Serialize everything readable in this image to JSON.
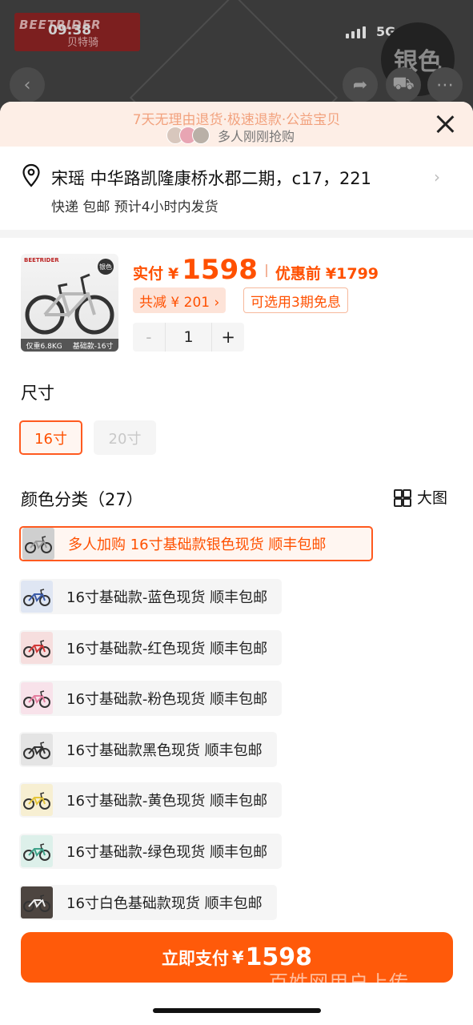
{
  "background": {
    "brand_en": "BEETRIDER",
    "brand_cn": "贝特骑",
    "status_time": "09:38",
    "network": "5G",
    "color_badge": "银色"
  },
  "banner": {
    "policies": "7天无理由退货·极速退款·公益宝贝",
    "buyers_text": "多人刚刚抢购"
  },
  "address": {
    "line": "宋瑶 中华路凯隆康桥水郡二期，c17，221",
    "delivery": "快递 包邮 预计4小时内发货"
  },
  "product": {
    "image_brand": "BEETRIDER",
    "image_badge": "银色",
    "image_weight": "仅重6.8KG",
    "image_variant": "基础款-16寸",
    "price_label": "实付",
    "currency": "¥",
    "price": "1598",
    "original_label": "优惠前",
    "original_price": "¥1799",
    "discount": "共减 ¥ 201 ›",
    "installment": "可选用3期免息",
    "quantity": "1",
    "minus": "-",
    "plus": "+"
  },
  "size": {
    "title": "尺寸",
    "options": [
      "16寸",
      "20寸"
    ]
  },
  "colors": {
    "title": "颜色分类（27）",
    "big_view": "大图",
    "options": [
      {
        "label": "多人加购  16寸基础款银色现货 顺丰包邮",
        "swatch": "#cfcfcf",
        "frame": "#9a9a9a"
      },
      {
        "label": "16寸基础款-蓝色现货 顺丰包邮",
        "swatch": "#dfe6f3",
        "frame": "#3b5ba8"
      },
      {
        "label": "16寸基础款-红色现货 顺丰包邮",
        "swatch": "#f6dede",
        "frame": "#d33a3a"
      },
      {
        "label": "16寸基础款-粉色现货 顺丰包邮",
        "swatch": "#f8e2ea",
        "frame": "#e57fa0"
      },
      {
        "label": "16寸基础款黑色现货 顺丰包邮",
        "swatch": "#e4e4e4",
        "frame": "#333333"
      },
      {
        "label": "16寸基础款-黄色现货 顺丰包邮",
        "swatch": "#f7efd2",
        "frame": "#e5c53a"
      },
      {
        "label": "16寸基础款-绿色现货 顺丰包邮",
        "swatch": "#ddf0ea",
        "frame": "#3fa38a"
      },
      {
        "label": "16寸白色基础款现货 顺丰包邮",
        "swatch": "#4d4540",
        "frame": "#eeeeee"
      }
    ]
  },
  "pay": {
    "label": "立即支付",
    "currency": "¥",
    "amount": "1598"
  },
  "watermark": "百姓网用户上传"
}
